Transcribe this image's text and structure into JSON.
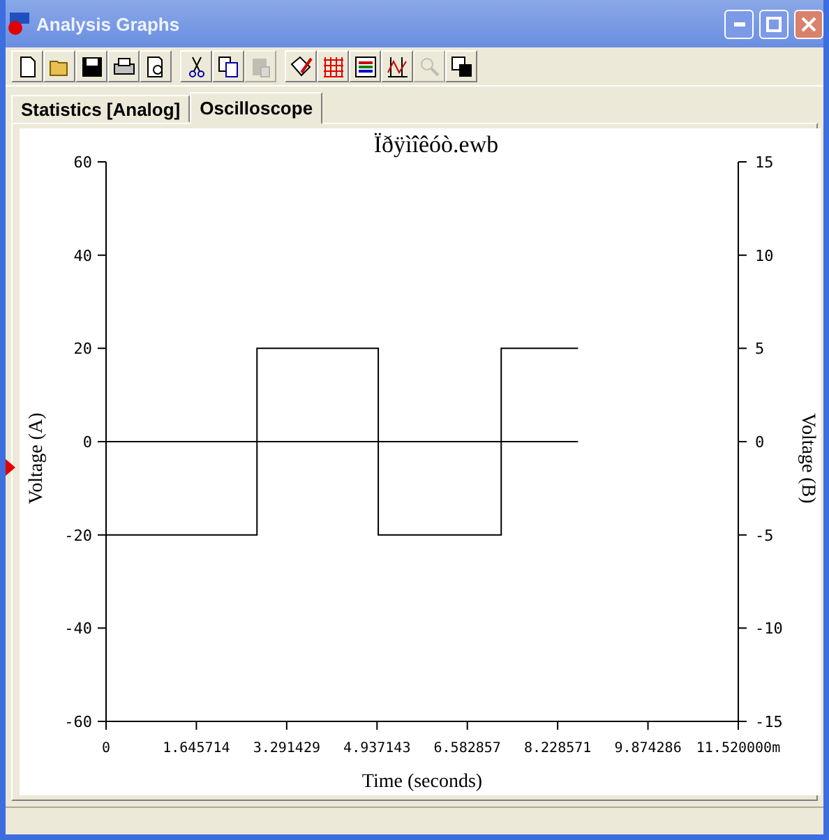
{
  "window": {
    "title": "Analysis Graphs"
  },
  "toolbar": [
    [
      {
        "kind": "new",
        "disabled": false
      },
      {
        "kind": "open",
        "disabled": false
      },
      {
        "kind": "save",
        "disabled": false
      },
      {
        "kind": "print",
        "disabled": false
      },
      {
        "kind": "preview",
        "disabled": false
      }
    ],
    [
      {
        "kind": "cut",
        "disabled": false
      },
      {
        "kind": "copy",
        "disabled": false
      },
      {
        "kind": "paste",
        "disabled": true
      }
    ],
    [
      {
        "kind": "properties",
        "disabled": false
      },
      {
        "kind": "grid",
        "disabled": false
      },
      {
        "kind": "legend",
        "disabled": false
      },
      {
        "kind": "cursors",
        "disabled": false
      },
      {
        "kind": "zoom",
        "disabled": true
      },
      {
        "kind": "reverse",
        "disabled": false
      }
    ]
  ],
  "tabs": [
    {
      "label": "Statistics [Analog]",
      "selected": false
    },
    {
      "label": "Oscilloscope",
      "selected": true
    }
  ],
  "graph": {
    "chart_data": {
      "type": "line",
      "title": "Ïðÿìîêóò.ewb",
      "xlabel": "Time (seconds)",
      "ylabel": "Voltage (A)",
      "y2label": "Voltage (B)",
      "x": [
        0,
        2.75,
        2.75,
        4.96,
        4.96,
        7.2,
        7.2,
        8.6
      ],
      "series": [
        {
          "color": "#000000",
          "values": [
            -20,
            -20,
            20,
            20,
            -20,
            -20,
            20,
            20
          ]
        },
        {
          "color": "#000000",
          "values": [
            0,
            0,
            0,
            0,
            0,
            0,
            0,
            0
          ]
        }
      ],
      "xlim": [
        0,
        11.52
      ],
      "ylim": [
        -60,
        60
      ],
      "y2lim": [
        -15,
        15
      ],
      "xticks": [
        {
          "value": 0,
          "label": "0"
        },
        {
          "value": 1.645714,
          "label": "1.645714"
        },
        {
          "value": 3.291429,
          "label": "3.291429"
        },
        {
          "value": 4.937143,
          "label": "4.937143"
        },
        {
          "value": 6.582857,
          "label": "6.582857"
        },
        {
          "value": 8.228571,
          "label": "8.228571"
        },
        {
          "value": 9.874286,
          "label": "9.874286"
        },
        {
          "value": 11.52,
          "label": "11.520000m"
        }
      ],
      "yticks": [
        60,
        40,
        20,
        0,
        -20,
        -40,
        -60
      ],
      "y2ticks": [
        15,
        10,
        5,
        0,
        -5,
        -10,
        -15
      ]
    }
  }
}
